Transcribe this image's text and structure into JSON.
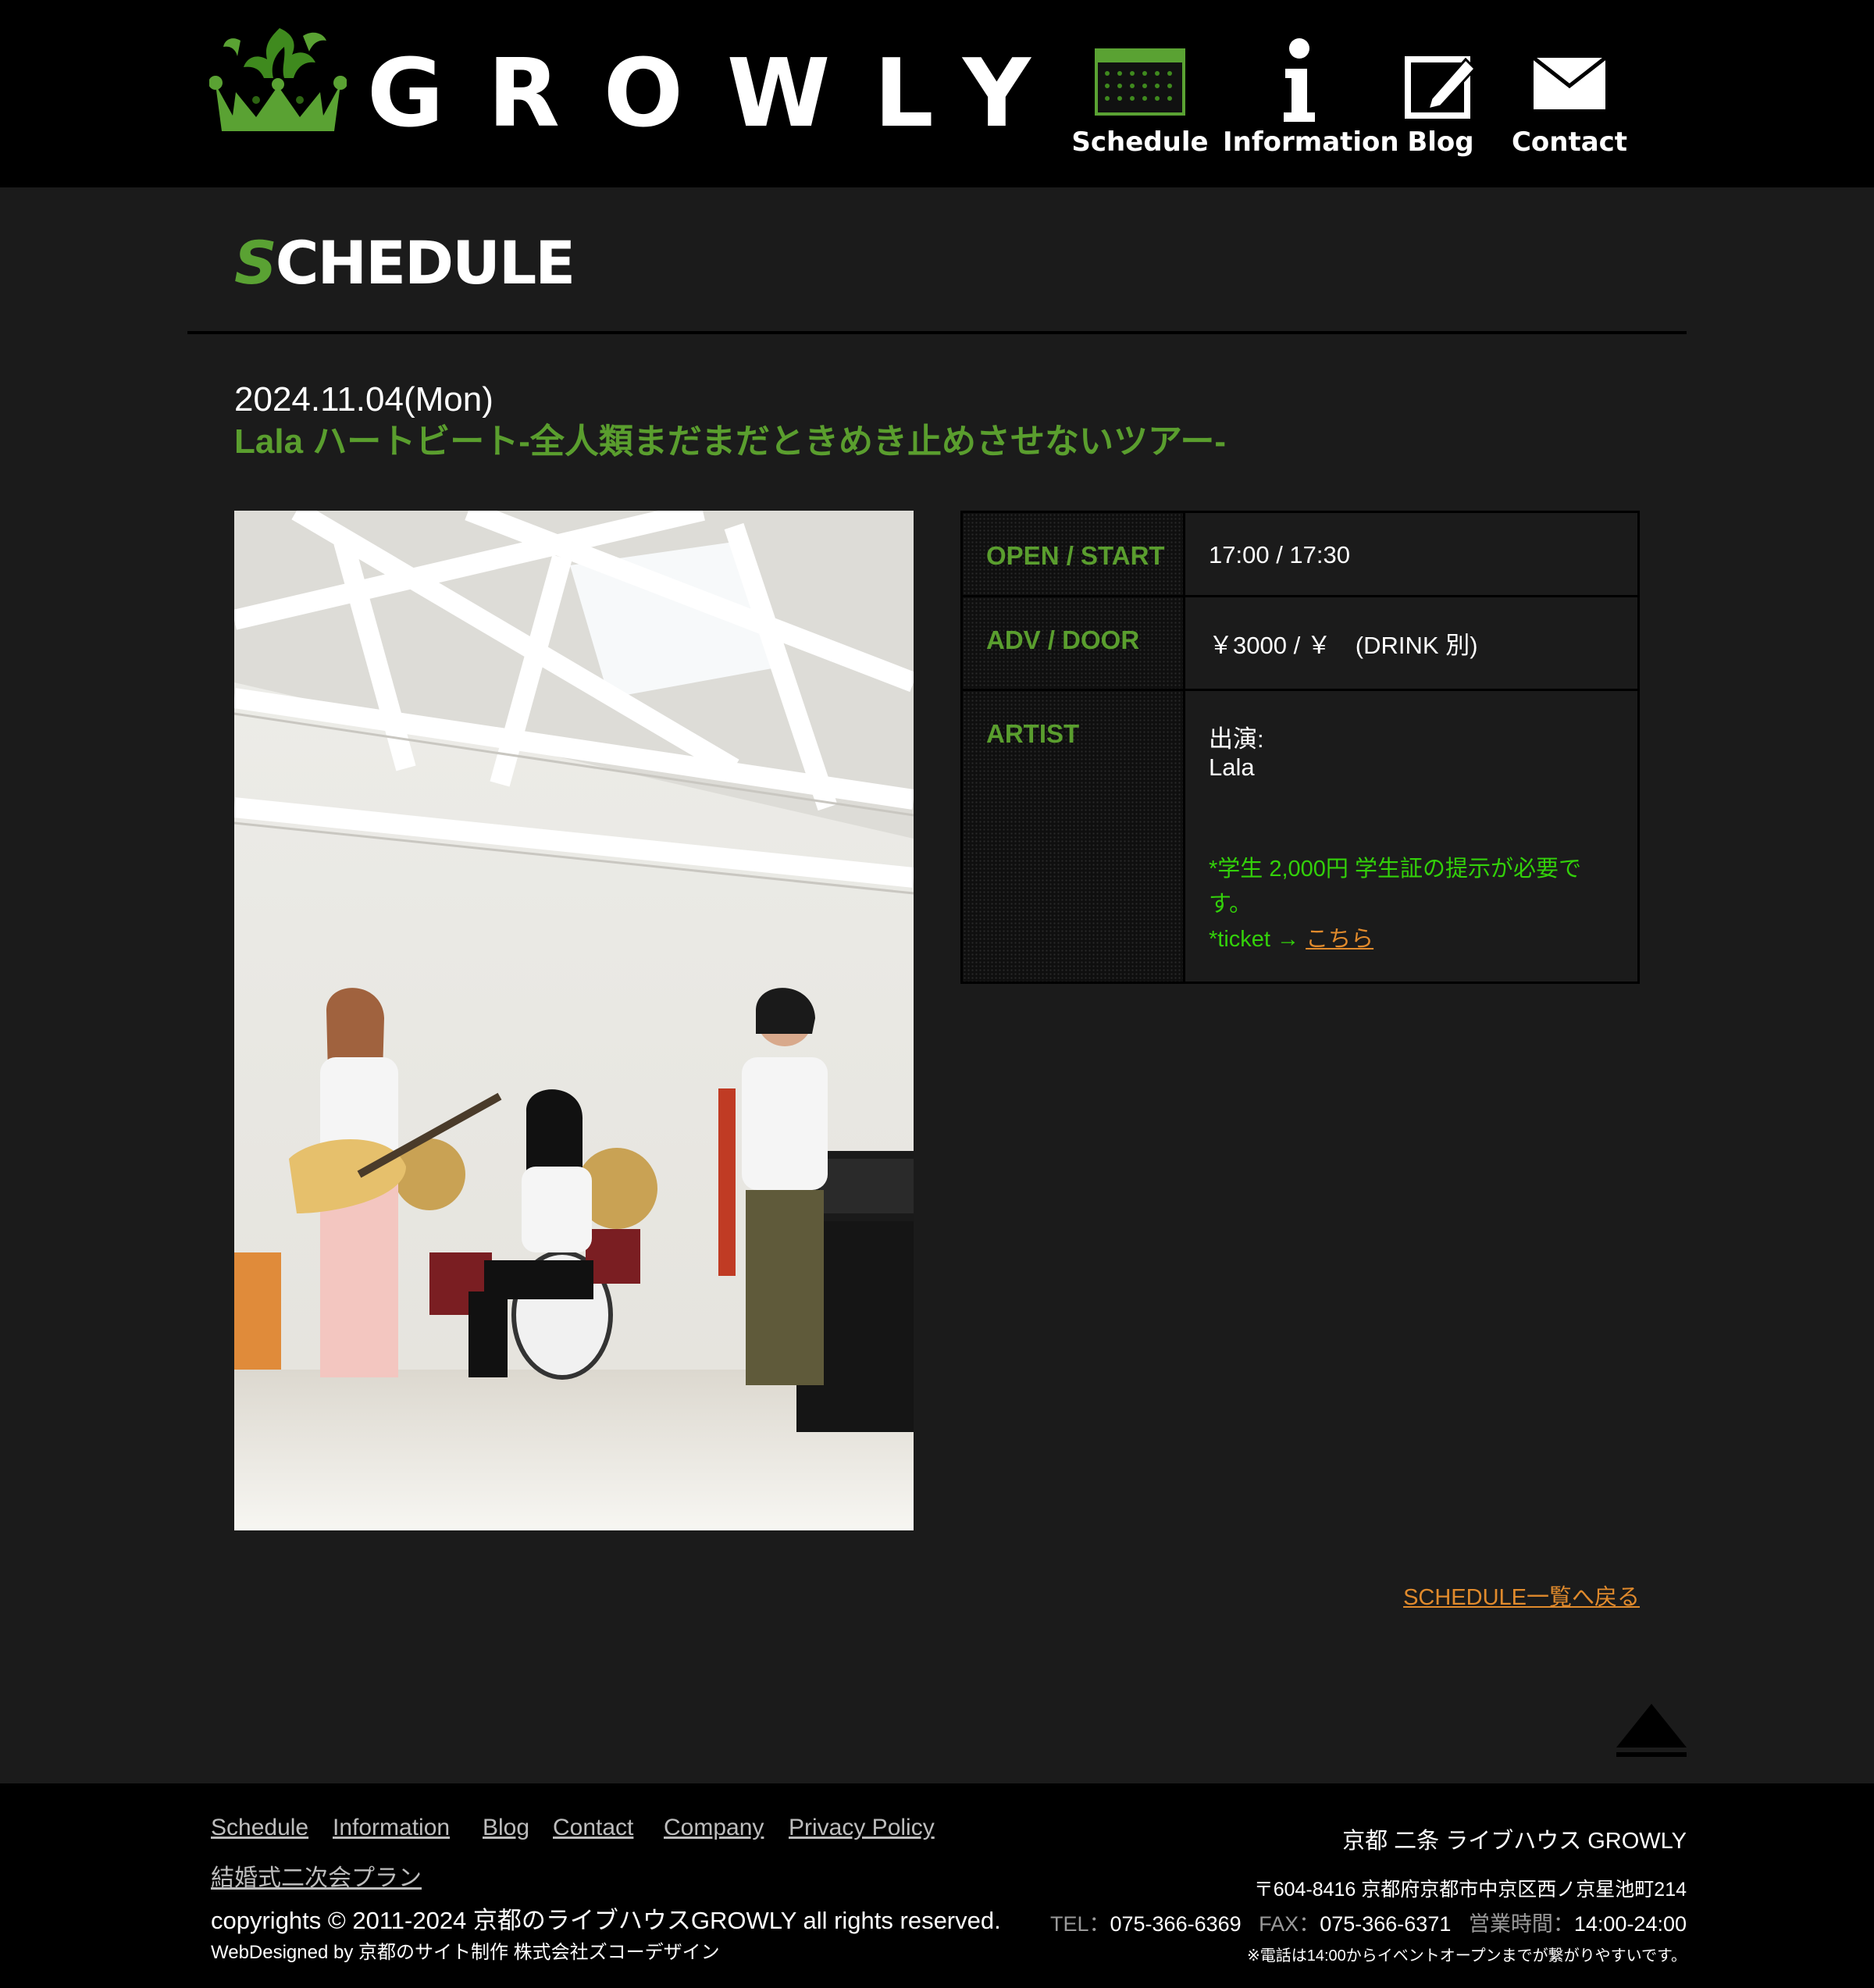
{
  "header": {
    "logo_text": "GROWLY",
    "nav": [
      {
        "label": "Schedule",
        "icon": "calendar-icon"
      },
      {
        "label": "Information",
        "icon": "info-icon"
      },
      {
        "label": "Blog",
        "icon": "pencil-note-icon"
      },
      {
        "label": "Contact",
        "icon": "envelope-icon"
      }
    ]
  },
  "section": {
    "title_first": "S",
    "title_rest": "CHEDULE"
  },
  "event": {
    "date": "2024.11.04(Mon)",
    "title": "Lala ハートビート-全人類まだまだときめき止めさせないツアー-",
    "photo_icon": "band-photo",
    "details": {
      "open_start_label": "OPEN / START",
      "open_start_value": "17:00 / 17:30",
      "price_label": "ADV / DOOR",
      "price_value": "￥3000 / ￥　(DRINK 別)",
      "artist_label": "ARTIST",
      "artist_heading": "出演:",
      "artist_name": "Lala",
      "student_note_line1": "*学生 2,000円 学生証の提示が必要で",
      "student_note_line2": "す。",
      "ticket_prefix": "*ticket → ",
      "ticket_link": "こちら"
    },
    "back_link": "SCHEDULE一覧へ戻る"
  },
  "colors": {
    "accent_green": "#5a9e2e",
    "note_green": "#33d10a",
    "link_orange": "#e08a2c",
    "background": "#1b1b1b",
    "header_bg": "#000000"
  },
  "footer": {
    "nav": [
      "Schedule",
      "Information",
      "Blog",
      "Contact",
      "Company",
      "Privacy Policy",
      "結婚式二次会プラン"
    ],
    "copyright": "copyrights © 2011-2024 京都のライブハウスGROWLY all rights reserved.",
    "webdesign": "WebDesigned by 京都のサイト制作 株式会社ズコーデザイン",
    "venue": "京都 二条 ライブハウス GROWLY",
    "address": "〒604-8416 京都府京都市中京区西ノ京星池町214",
    "tel_label": "TEL：",
    "tel": "075-366-6369",
    "fax_label": "FAX：",
    "fax": "075-366-6371",
    "hours_label": "営業時間：",
    "hours": "14:00-24:00",
    "phone_note": "※電話は14:00からイベントオープンまでが繋がりやすいです。"
  }
}
